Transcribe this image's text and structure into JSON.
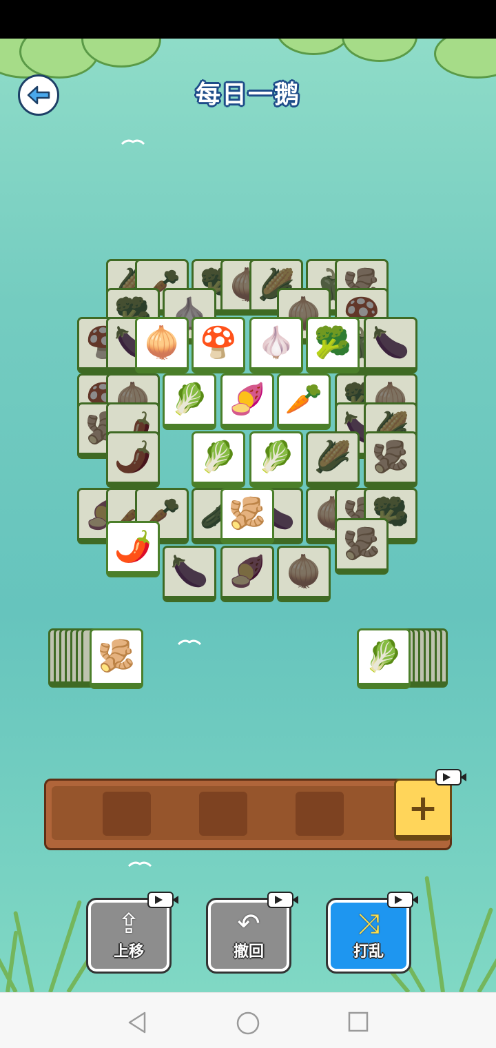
{
  "header": {
    "title": "每日一鹅",
    "back_icon": "back-arrow-icon"
  },
  "board": {
    "active_tiles": [
      {
        "name": "onion",
        "glyph": "🧅"
      },
      {
        "name": "mushroom",
        "glyph": "🍄"
      },
      {
        "name": "turnip",
        "glyph": "🧄"
      },
      {
        "name": "broccoli",
        "glyph": "🥦"
      },
      {
        "name": "cabbage",
        "glyph": "🥬"
      },
      {
        "name": "sweet-potato",
        "glyph": "🍠"
      },
      {
        "name": "carrot",
        "glyph": "🥕"
      },
      {
        "name": "cabbage",
        "glyph": "🥬"
      },
      {
        "name": "cabbage",
        "glyph": "🥬"
      },
      {
        "name": "ginger",
        "glyph": "🫚"
      }
    ],
    "blocked_tiles": [
      {
        "name": "corn",
        "glyph": "🌽"
      },
      {
        "name": "carrot",
        "glyph": "🥕"
      },
      {
        "name": "broccoli",
        "glyph": "🥦"
      },
      {
        "name": "onion",
        "glyph": "🧅"
      },
      {
        "name": "corn",
        "glyph": "🌽"
      },
      {
        "name": "pepper",
        "glyph": "🫑"
      },
      {
        "name": "ginger",
        "glyph": "🫚"
      },
      {
        "name": "broccoli",
        "glyph": "🥦"
      },
      {
        "name": "turnip",
        "glyph": "🧄"
      },
      {
        "name": "onion",
        "glyph": "🧅"
      },
      {
        "name": "mushroom",
        "glyph": "🍄"
      },
      {
        "name": "mushroom",
        "glyph": "🍄"
      },
      {
        "name": "eggplant",
        "glyph": "🍆"
      },
      {
        "name": "pepper",
        "glyph": "🫑"
      },
      {
        "name": "eggplant",
        "glyph": "🍆"
      },
      {
        "name": "mushroom",
        "glyph": "🍄"
      },
      {
        "name": "onion",
        "glyph": "🧅"
      },
      {
        "name": "broccoli",
        "glyph": "🥦"
      },
      {
        "name": "onion",
        "glyph": "🧅"
      },
      {
        "name": "ginger",
        "glyph": "🫚"
      },
      {
        "name": "chili",
        "glyph": "🌶️"
      },
      {
        "name": "eggplant",
        "glyph": "🍆"
      },
      {
        "name": "corn",
        "glyph": "🌽"
      },
      {
        "name": "chili",
        "glyph": "🌶️"
      },
      {
        "name": "corn",
        "glyph": "🌽"
      },
      {
        "name": "ginger",
        "glyph": "🫚"
      },
      {
        "name": "carrot",
        "glyph": "🥕"
      },
      {
        "name": "sweet-potato",
        "glyph": "🍠"
      },
      {
        "name": "carrot",
        "glyph": "🥕"
      },
      {
        "name": "carrot",
        "glyph": "🥕"
      },
      {
        "name": "cucumber",
        "glyph": "🥒"
      },
      {
        "name": "eggplant",
        "glyph": "🍆"
      },
      {
        "name": "leek",
        "glyph": "🧅"
      },
      {
        "name": "ginger",
        "glyph": "🫚"
      },
      {
        "name": "broccoli",
        "glyph": "🥦"
      },
      {
        "name": "chili",
        "glyph": "🌶️"
      },
      {
        "name": "eggplant",
        "glyph": "🍆"
      },
      {
        "name": "sweet-potato",
        "glyph": "🍠"
      },
      {
        "name": "leek",
        "glyph": "🧅"
      },
      {
        "name": "ginger",
        "glyph": "🫚"
      }
    ]
  },
  "left_stack": {
    "top": {
      "name": "ginger",
      "glyph": "🫚"
    }
  },
  "right_stack": {
    "top": {
      "name": "cabbage",
      "glyph": "🥬"
    }
  },
  "tray": {
    "plus_label": "+",
    "video_icon": "video-ad-icon"
  },
  "powerups": [
    {
      "name": "move-up",
      "label": "上移",
      "icon": "upload-icon",
      "glyph": "⇪",
      "color": "gray"
    },
    {
      "name": "undo",
      "label": "撤回",
      "icon": "undo-icon",
      "glyph": "↶",
      "color": "gray"
    },
    {
      "name": "shuffle",
      "label": "打乱",
      "icon": "shuffle-icon",
      "glyph": "⤨",
      "color": "blue"
    }
  ],
  "nav": {
    "back_icon": "nav-back-icon",
    "home_icon": "nav-home-icon",
    "recents_icon": "nav-recents-icon"
  }
}
